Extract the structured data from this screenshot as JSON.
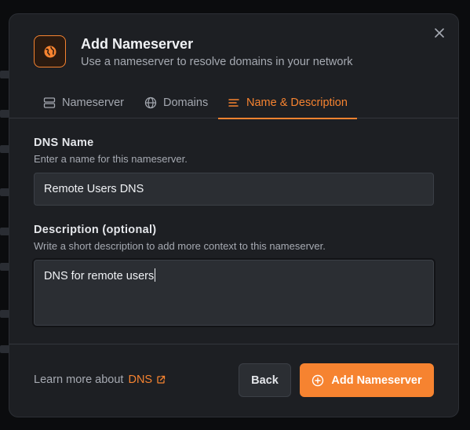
{
  "dialog": {
    "title": "Add Nameserver",
    "subtitle": "Use a nameserver to resolve domains in your network",
    "close_icon": "close-icon",
    "header_icon": "globe-pin-icon"
  },
  "tabs": [
    {
      "label": "Nameserver",
      "icon": "server-icon",
      "active": false
    },
    {
      "label": "Domains",
      "icon": "globe-icon",
      "active": false
    },
    {
      "label": "Name & Description",
      "icon": "text-lines-icon",
      "active": true
    }
  ],
  "form": {
    "dns_name": {
      "label": "DNS Name",
      "help": "Enter a name for this nameserver.",
      "value": "Remote Users DNS"
    },
    "description": {
      "label": "Description (optional)",
      "help": "Write a short description to add more context to this nameserver.",
      "value": "DNS for remote users"
    }
  },
  "footer": {
    "learn_prefix": "Learn more about",
    "learn_link": "DNS",
    "back_label": "Back",
    "submit_label": "Add Nameserver"
  },
  "colors": {
    "accent": "#f68330",
    "dialog_bg": "#1d1f23",
    "input_bg": "#2b2e33"
  }
}
